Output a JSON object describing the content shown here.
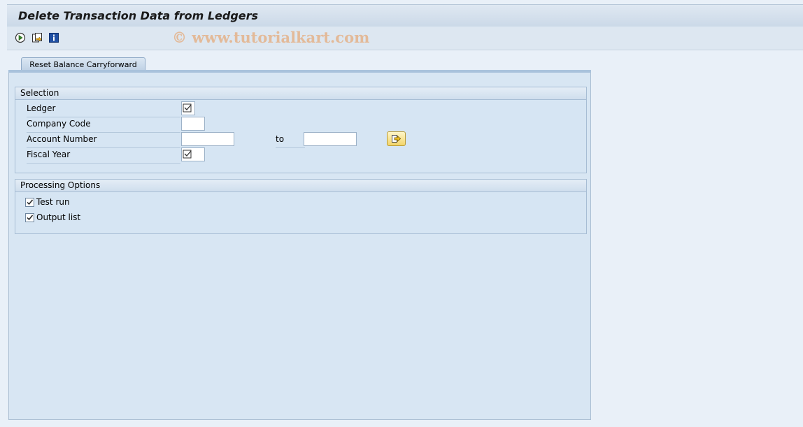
{
  "window": {
    "title": "Delete Transaction Data from Ledgers"
  },
  "toolbar": {
    "buttons": [
      {
        "icon": "execute-icon"
      },
      {
        "icon": "get-variant-icon"
      },
      {
        "icon": "info-icon"
      }
    ],
    "watermark": "© www.tutorialkart.com"
  },
  "tabs": [
    {
      "label": "Reset Balance Carryforward"
    }
  ],
  "selection": {
    "title": "Selection",
    "ledger": {
      "label": "Ledger",
      "value": ""
    },
    "company_code": {
      "label": "Company Code",
      "value": ""
    },
    "account_number": {
      "label": "Account Number",
      "from": "",
      "to_label": "to",
      "to": ""
    },
    "fiscal_year": {
      "label": "Fiscal Year",
      "value": ""
    }
  },
  "processing": {
    "title": "Processing Options",
    "test_run": {
      "label": "Test run",
      "checked": true
    },
    "output_list": {
      "label": "Output list",
      "checked": true
    }
  }
}
